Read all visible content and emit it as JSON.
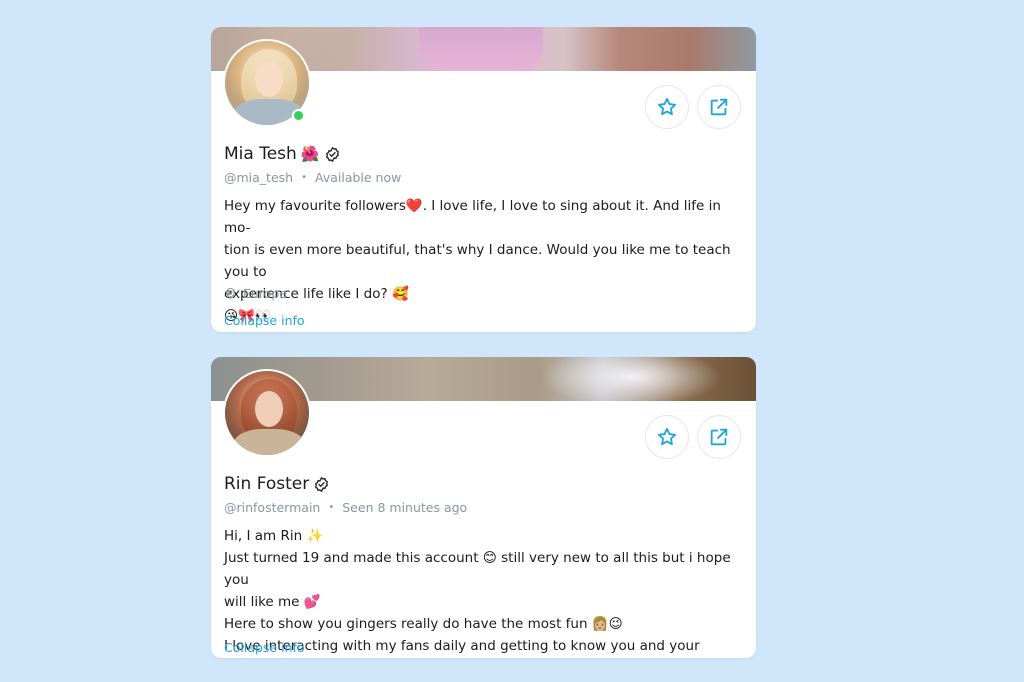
{
  "profiles": [
    {
      "name": "Mia Tesh",
      "name_emoji": "🌺",
      "handle": "@mia_tesh",
      "status": "Available now",
      "bio_lines": [
        "Hey my favourite followers❤️. I love life, I love to sing about it. And life in mo-",
        "tion is even more beautiful, that's why I dance. Would you like me to teach you to",
        "experience life like I do? 🥰",
        "😘🎀👀"
      ],
      "location": "Europe",
      "collapse_label": "Collapse info",
      "online": true
    },
    {
      "name": "Rin Foster",
      "name_emoji": "",
      "handle": "@rinfostermain",
      "status": "Seen  8 minutes ago",
      "bio_lines": [
        "Hi, I am Rin ✨",
        "Just turned 19 and made this account 😊 still very new to all this but i hope you",
        "will like me 💕",
        "Here to show you gingers really do have the most fun 👩🏼😉",
        "I love interacting with my fans daily and getting to know you and your fantasies!"
      ],
      "collapse_label": "Collapse info",
      "online": false
    }
  ],
  "icons": {
    "favorite": "star-icon",
    "share": "share-icon",
    "verified": "verified-check-icon",
    "location": "map-pin-icon"
  },
  "colors": {
    "background": "#cfe6fb",
    "accent": "#1ea6d8",
    "online": "#35d05a",
    "muted_text": "#8a96a3"
  }
}
